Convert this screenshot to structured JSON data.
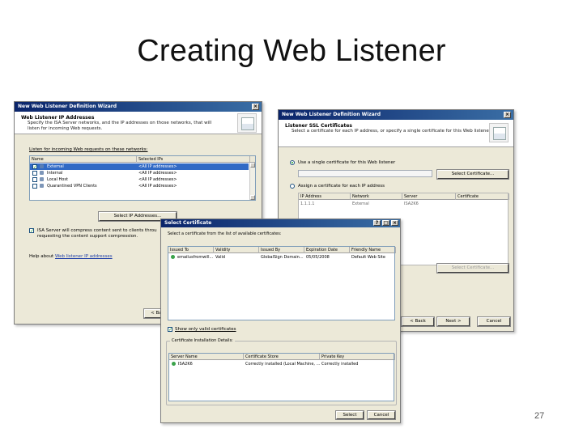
{
  "slide": {
    "title": "Creating Web Listener",
    "page_number": "27"
  },
  "wizard_ip": {
    "title": "New Web Listener Definition Wizard",
    "heading": "Web Listener IP Addresses",
    "description": "Specify the ISA Server networks, and the IP addresses on those networks, that will listen for incoming Web requests.",
    "listen_label": "Listen for incoming Web requests on these networks:",
    "columns": [
      "Name",
      "Selected IPs"
    ],
    "rows": [
      {
        "name": "External",
        "ips": "<All IP addresses>",
        "checked": true,
        "selected": true
      },
      {
        "name": "Internal",
        "ips": "<All IP addresses>",
        "checked": false,
        "selected": false
      },
      {
        "name": "Local Host",
        "ips": "<All IP addresses>",
        "checked": false,
        "selected": false
      },
      {
        "name": "Quarantined VPN Clients",
        "ips": "<All IP addresses>",
        "checked": false,
        "selected": false
      }
    ],
    "select_ip_button": "Select IP Addresses...",
    "compress_text_1": "ISA Server will compress content sent to clients throu",
    "compress_text_2": "requesting the content support compression.",
    "help_prefix": "Help about ",
    "help_link": "Web listener IP addresses",
    "back_button": "< Back"
  },
  "wizard_ssl": {
    "title": "New Web Listener Definition Wizard",
    "heading": "Listener SSL Certificates",
    "description": "Select a certificate for each IP address, or specify a single certificate for this Web listener.",
    "use_single_label": "Use a single certificate for this Web listener",
    "select_cert_button": "Select Certificate...",
    "assign_label": "Assign a certificate for each IP address",
    "columns": [
      "IP Address",
      "Network",
      "Server",
      "Certificate"
    ],
    "rows": [
      {
        "ip": "1.1.1.1",
        "network": "External",
        "server": "ISA2K6",
        "certificate": ""
      }
    ],
    "select_cert_button_2": "Select Certificate...",
    "back_button": "< Back",
    "next_button": "Next >",
    "cancel_button": "Cancel"
  },
  "select_cert": {
    "title": "Select Certificate",
    "description": "Select a certificate from the list of available certificates:",
    "columns": [
      "Issued To",
      "Validity",
      "Issued By",
      "Expiration Date",
      "Friendly Name"
    ],
    "rows": [
      {
        "issued_to": "emailusfromwill...",
        "validity": "Valid",
        "issued_by": "GlobalSign Domain...",
        "expiration": "05/05/2008",
        "friendly": "Default Web Site"
      }
    ],
    "show_valid_label": "Show only valid certificates",
    "details_label": "Certificate Installation Details:",
    "detail_columns": [
      "Server Name",
      "Certificate Store",
      "Private Key"
    ],
    "detail_rows": [
      {
        "server": "ISA2K6",
        "store": "Correctly installed (Local Machine, ...",
        "key": "Correctly installed"
      }
    ],
    "select_button": "Select",
    "cancel_button": "Cancel"
  },
  "colors": {
    "titlebar": "#0a246a",
    "dialog_bg": "#ece9d8",
    "selection": "#316ac5"
  }
}
